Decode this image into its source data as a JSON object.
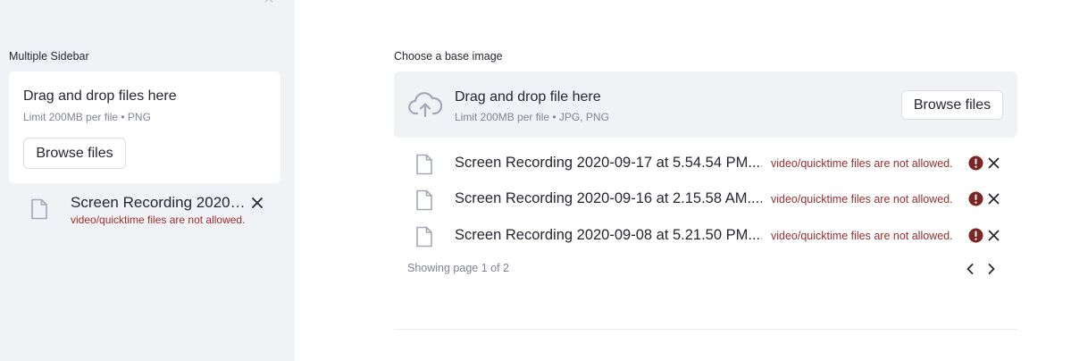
{
  "sidebar": {
    "close_glyph": "×",
    "label": "Multiple Sidebar",
    "uploader": {
      "title": "Drag and drop files here",
      "limit": "Limit 200MB per file • PNG",
      "browse_label": "Browse files"
    },
    "file": {
      "name": "Screen Recording 2020-0...",
      "error": "video/quicktime files are not allowed.",
      "icon": "file-icon"
    }
  },
  "main": {
    "label": "Choose a base image",
    "uploader": {
      "title": "Drag and drop file here",
      "limit": "Limit 200MB per file • JPG, PNG",
      "browse_label": "Browse files",
      "icon": "cloud-upload-icon"
    },
    "files": [
      {
        "name": "Screen Recording 2020-09-17 at 5.54.54 PM....",
        "error": "video/quicktime files are not allowed."
      },
      {
        "name": "Screen Recording 2020-09-16 at 2.15.58 AM....",
        "error": "video/quicktime files are not allowed."
      },
      {
        "name": "Screen Recording 2020-09-08 at 5.21.50 PM....",
        "error": "video/quicktime files are not allowed."
      }
    ],
    "pagination": {
      "text": "Showing page 1 of 2"
    }
  },
  "colors": {
    "sidebar_bg": "#f0f2f6",
    "error_text": "#9a2d2d",
    "error_icon": "#7d2525",
    "muted_text": "#808495"
  }
}
